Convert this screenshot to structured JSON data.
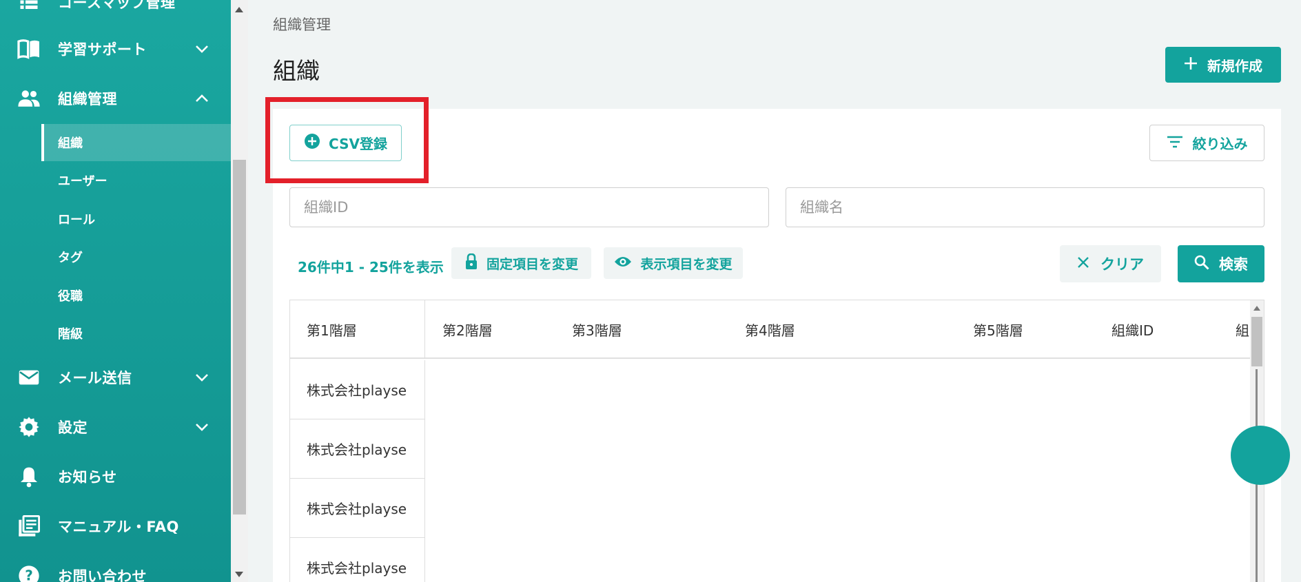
{
  "sidebar": {
    "items": [
      {
        "label": "コースマップ管理",
        "icon": "list-icon"
      },
      {
        "label": "学習サポート",
        "icon": "book-icon",
        "expanded": false
      },
      {
        "label": "組織管理",
        "icon": "people-icon",
        "expanded": true
      },
      {
        "label": "メール送信",
        "icon": "mail-icon",
        "expanded": false
      },
      {
        "label": "設定",
        "icon": "gear-icon",
        "expanded": false
      },
      {
        "label": "お知らせ",
        "icon": "bell-icon"
      },
      {
        "label": "マニュアル・FAQ",
        "icon": "manual-icon"
      },
      {
        "label": "お問い合わせ",
        "icon": "help-icon"
      }
    ],
    "subitems": [
      {
        "label": "組織",
        "active": true
      },
      {
        "label": "ユーザー"
      },
      {
        "label": "ロール"
      },
      {
        "label": "タグ"
      },
      {
        "label": "役職"
      },
      {
        "label": "階級"
      }
    ]
  },
  "header": {
    "breadcrumb": "組織管理",
    "title": "組織",
    "new_button": "新規作成"
  },
  "toolbar": {
    "csv_button": "CSV登録",
    "filter_button": "絞り込み",
    "count_text": "26件中1 - 25件を表示",
    "fixed_columns_button": "固定項目を変更",
    "display_columns_button": "表示項目を変更",
    "clear_button": "クリア",
    "search_button": "検索"
  },
  "search": {
    "org_id_placeholder": "組織ID",
    "org_name_placeholder": "組織名"
  },
  "table": {
    "columns": [
      "第1階層",
      "第2階層",
      "第3階層",
      "第4階層",
      "第5階層",
      "組織ID",
      "組"
    ],
    "rows": [
      [
        "株式会社playse"
      ],
      [
        "株式会社playse"
      ],
      [
        "株式会社playse"
      ],
      [
        "株式会社playse"
      ]
    ]
  },
  "colors": {
    "accent": "#13a39d",
    "sidebar": "#1aa7a0",
    "highlight": "#e3202a"
  }
}
